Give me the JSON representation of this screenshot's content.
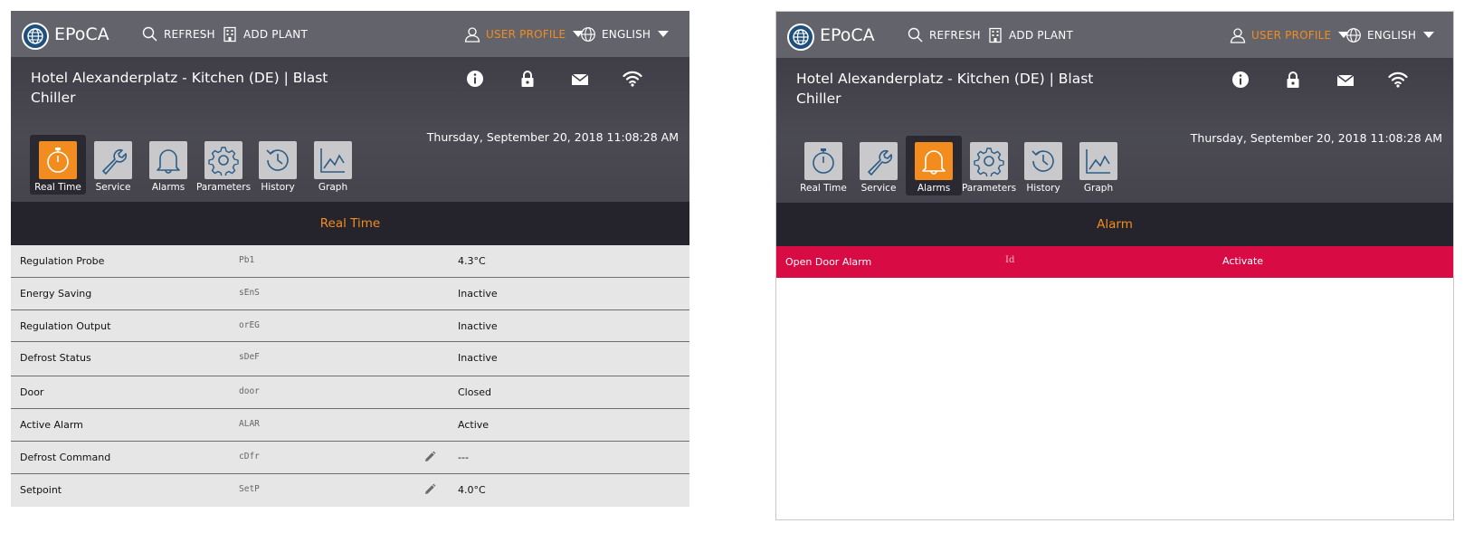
{
  "app": {
    "brand": "EPoCA",
    "refresh_label": "REFRESH",
    "add_plant_label": "ADD PLANT",
    "user_profile_label": "USER PROFILE",
    "language_label": "ENGLISH"
  },
  "header": {
    "site_title": "Hotel Alexanderplatz - Kitchen (DE) | Blast Chiller",
    "datetime": "Thursday, September 20, 2018 11:08:28 AM",
    "icons": [
      "info-icon",
      "lock-icon",
      "mail-icon",
      "wifi-icon"
    ]
  },
  "nav": {
    "tabs": [
      {
        "label": "Real Time",
        "icon": "stopwatch-icon"
      },
      {
        "label": "Service",
        "icon": "wrench-icon"
      },
      {
        "label": "Alarms",
        "icon": "bell-icon"
      },
      {
        "label": "Parameters",
        "icon": "gear-icon"
      },
      {
        "label": "History",
        "icon": "history-icon"
      },
      {
        "label": "Graph",
        "icon": "graph-icon"
      }
    ]
  },
  "left_panel": {
    "active_tab": "Real Time",
    "section_title": "Real Time",
    "rows": [
      {
        "label": "Regulation Probe",
        "code": "Pb1",
        "value": "4.3°C",
        "editable": false
      },
      {
        "label": "Energy Saving",
        "code": "sEnS",
        "value": "Inactive",
        "editable": false
      },
      {
        "label": "Regulation Output",
        "code": "orEG",
        "value": "Inactive",
        "editable": false
      },
      {
        "label": "Defrost Status",
        "code": "sDeF",
        "value": "Inactive",
        "editable": false
      },
      {
        "label": "Door",
        "code": "door",
        "value": "Closed",
        "editable": false
      },
      {
        "label": "Active Alarm",
        "code": "ALAR",
        "value": "Active",
        "editable": false
      },
      {
        "label": "Defrost Command",
        "code": "cDfr",
        "value": "---",
        "editable": true
      },
      {
        "label": "Setpoint",
        "code": "SetP",
        "value": "4.0°C",
        "editable": true
      }
    ]
  },
  "right_panel": {
    "active_tab": "Alarms",
    "section_title": "Alarm",
    "alarm": {
      "name": "Open Door Alarm",
      "id": "Id",
      "status": "Activate"
    }
  },
  "colors": {
    "accent": "#f28c1e",
    "topbar": "#63636b",
    "header": "#45444d",
    "section_band": "#25242c",
    "row_bg": "#e6e6e6",
    "alarm": "#d90b45"
  }
}
